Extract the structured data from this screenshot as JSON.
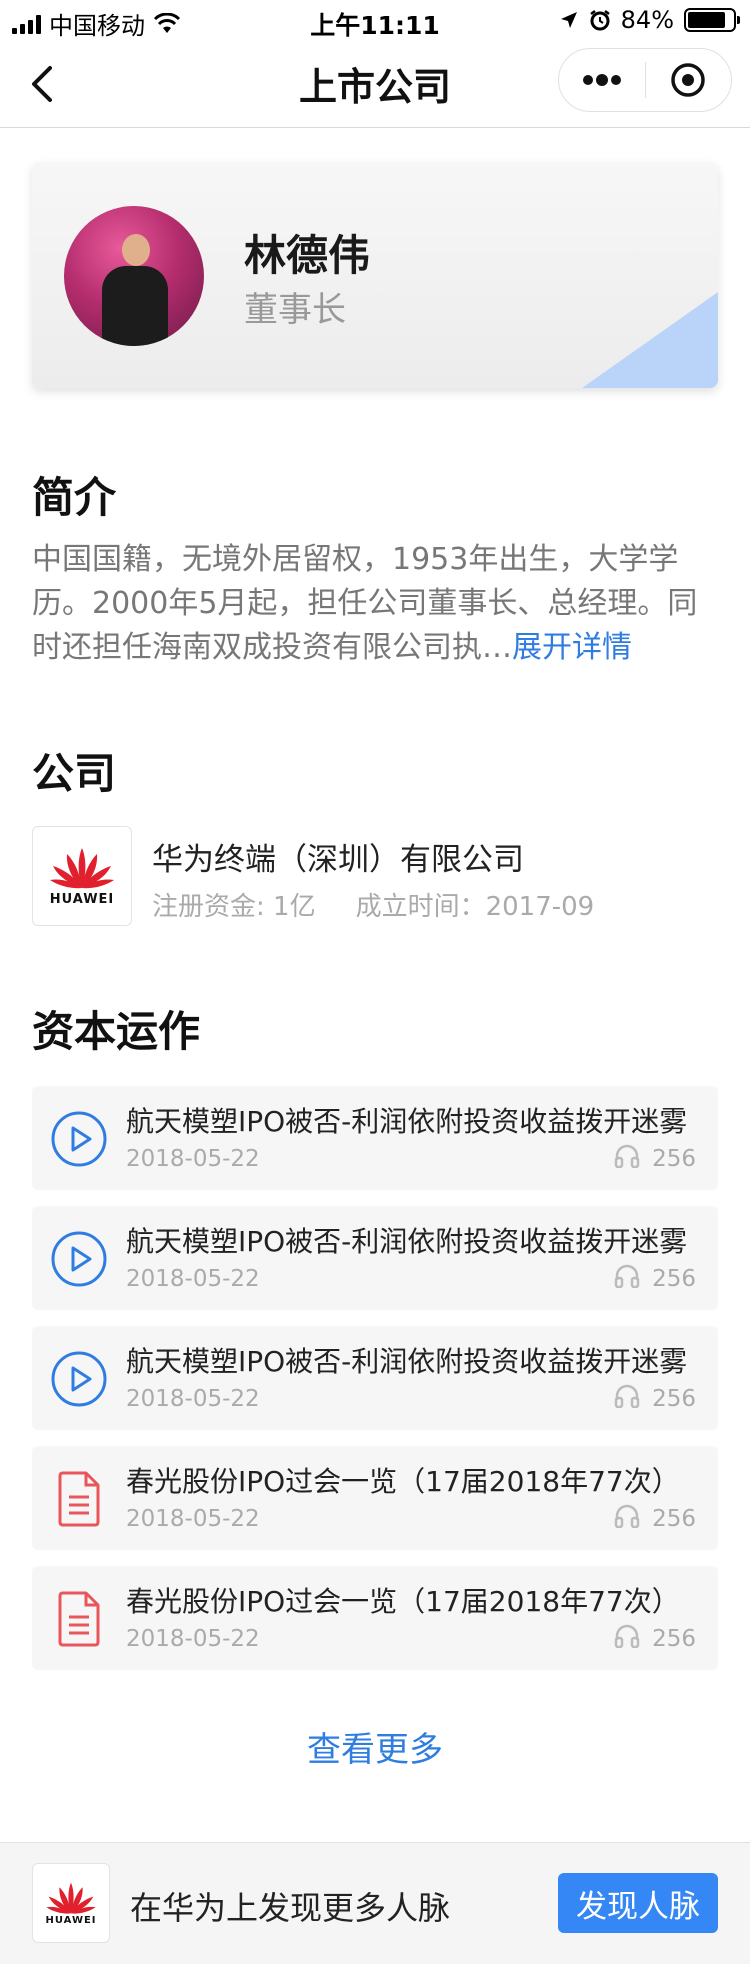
{
  "status_bar": {
    "carrier": "中国移动",
    "time": "上午11:11",
    "battery": "84%",
    "battery_level": 0.84
  },
  "nav": {
    "title": "上市公司"
  },
  "profile": {
    "name": "林德伟",
    "role": "董事长"
  },
  "intro": {
    "heading": "简介",
    "text": "中国国籍，无境外居留权，1953年出生，大学学历。2000年5月起，担任公司董事长、总经理。同时还担任海南双成投资有限公司执…",
    "expand_label": "展开详情"
  },
  "company": {
    "heading": "公司",
    "logo_wordmark": "HUAWEI",
    "name": "华为终端（深圳）有限公司",
    "capital": "注册资金: 1亿",
    "founded": "成立时间：2017-09"
  },
  "capital_ops": {
    "heading": "资本运作",
    "items": [
      {
        "icon": "play-icon",
        "title": "航天模塑IPO被否-利润依附投资收益拨开迷雾",
        "date": "2018-05-22",
        "plays": "256"
      },
      {
        "icon": "play-icon",
        "title": "航天模塑IPO被否-利润依附投资收益拨开迷雾",
        "date": "2018-05-22",
        "plays": "256"
      },
      {
        "icon": "play-icon",
        "title": "航天模塑IPO被否-利润依附投资收益拨开迷雾",
        "date": "2018-05-22",
        "plays": "256"
      },
      {
        "icon": "document-icon",
        "title": "春光股份IPO过会一览（17届2018年77次）",
        "date": "2018-05-22",
        "plays": "256"
      },
      {
        "icon": "document-icon",
        "title": "春光股份IPO过会一览（17届2018年77次）",
        "date": "2018-05-22",
        "plays": "256"
      }
    ],
    "see_more": "查看更多"
  },
  "bottom": {
    "logo_wordmark": "HUAWEI",
    "text": "在华为上发现更多人脉",
    "button": "发现人脉"
  },
  "colors": {
    "accent": "#2f7de1",
    "button": "#3487f4",
    "play_icon": "#2f7de1",
    "doc_icon": "#e8555a",
    "huawei_red": "#e0202c"
  }
}
